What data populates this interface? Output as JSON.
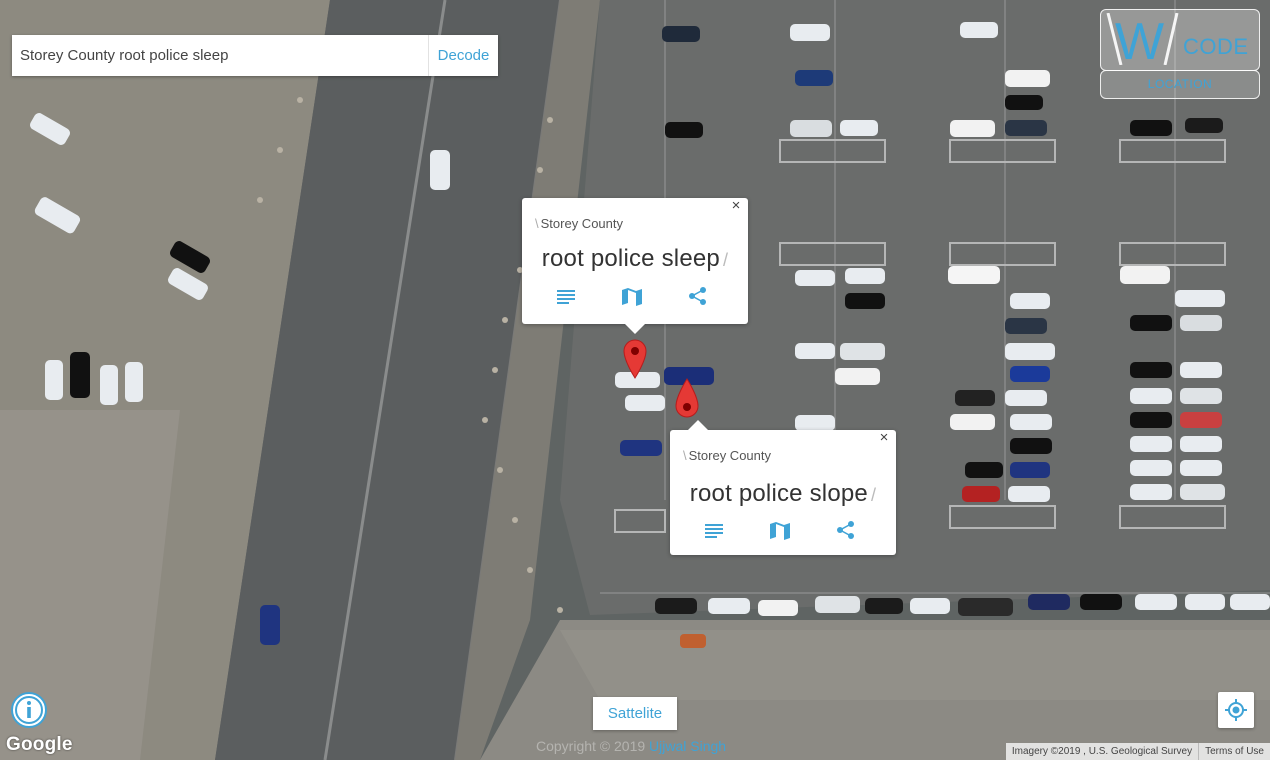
{
  "search": {
    "value": "Storey County root police sleep",
    "decode_label": "Decode"
  },
  "logo": {
    "letter": "W",
    "text": "CODE",
    "location_label": "LOCATION"
  },
  "popups": [
    {
      "region": "Storey County",
      "words": "root police sleep",
      "close": "×"
    },
    {
      "region": "Storey County",
      "words": "root police slope",
      "close": "×"
    }
  ],
  "controls": {
    "map_type_label": "Sattelite",
    "copyright_prefix": "Copyright © 2019",
    "copyright_author": "Ujjwal Singh"
  },
  "map_footer": {
    "google": "Google",
    "imagery": "Imagery ©2019 , U.S. Geological Survey",
    "terms": "Terms of Use"
  },
  "colors": {
    "accent": "#3fa3d6",
    "marker": "#e53935"
  },
  "icons": [
    "list-icon",
    "map-icon",
    "share-icon",
    "close-icon",
    "marker-icon",
    "my-location-icon",
    "info-icon"
  ]
}
